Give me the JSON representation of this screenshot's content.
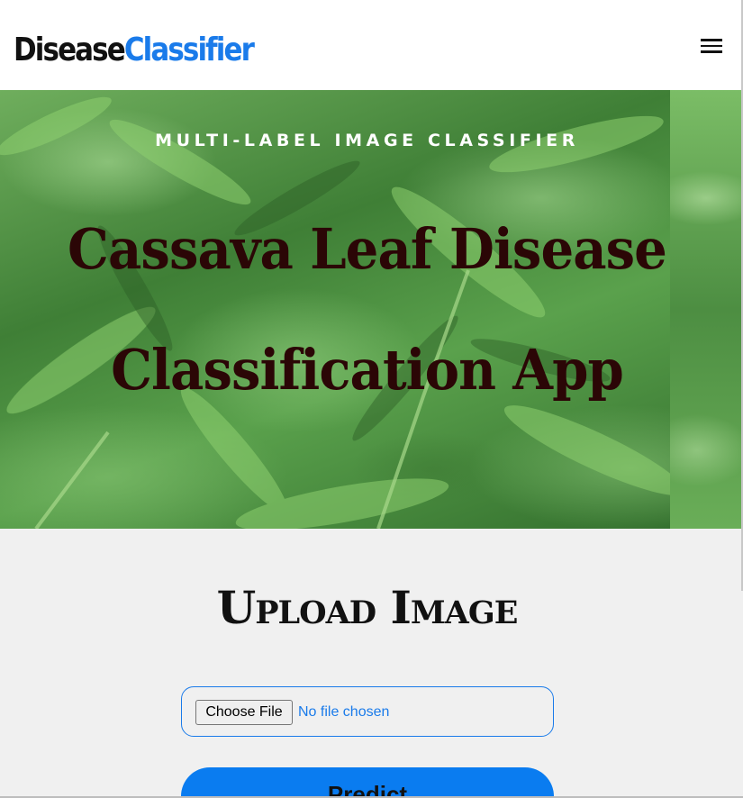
{
  "navbar": {
    "brand_part1": "Disease",
    "brand_part2": "Classifier",
    "menu_icon": "hamburger-menu-icon"
  },
  "hero": {
    "subtitle": "MULTI-LABEL IMAGE CLASSIFIER",
    "title_line1": "Cassava Leaf Disease",
    "title_line2": "Classification App"
  },
  "upload": {
    "heading": "Upload Image",
    "choose_file_label": "Choose File",
    "file_status": "No file chosen",
    "predict_label": "Predict"
  },
  "colors": {
    "accent": "#1a7bea",
    "predict_button": "#0a7cf0",
    "hero_title": "#2b0606"
  }
}
